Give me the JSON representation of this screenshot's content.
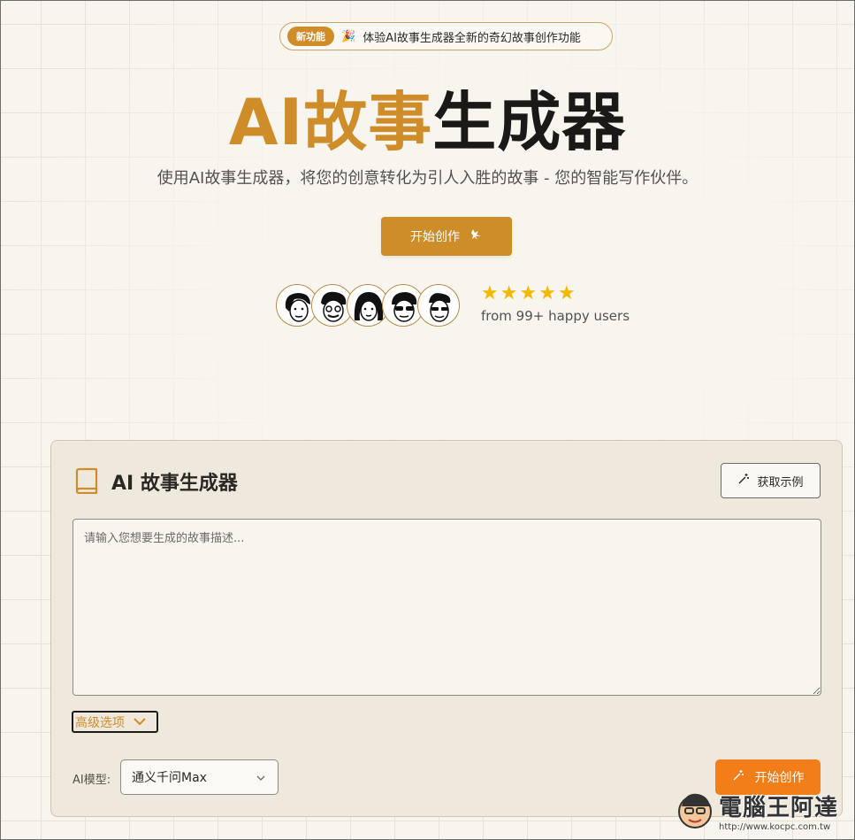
{
  "announcement": {
    "badge": "新功能",
    "text": "体验AI故事生成器全新的奇幻故事创作功能",
    "icon": "party-popper-icon"
  },
  "hero": {
    "title_accent": "AI故事",
    "title_dark": "生成器",
    "subtitle": "使用AI故事生成器，将您的创意转化为引人入胜的故事 - 您的智能写作伙伴。",
    "cta_label": "开始创作"
  },
  "social_proof": {
    "avatar_count": 5,
    "rating": 5,
    "stars": [
      "★",
      "★",
      "★",
      "★",
      "★"
    ],
    "users_text": "from 99+ happy users"
  },
  "generator": {
    "title": "AI 故事生成器",
    "example_button": "获取示例",
    "prompt_placeholder": "请输入您想要生成的故事描述...",
    "prompt_value": "",
    "advanced_label": "高级选项",
    "model_label": "AI模型:",
    "model_value": "通义千问Max",
    "submit_label": "开始创作"
  },
  "watermark": {
    "name": "電腦王阿達",
    "url": "http://www.kocpc.com.tw"
  },
  "colors": {
    "accent": "#cf8d2a",
    "submit": "#f27e1a",
    "background": "#f8f5ef",
    "card": "#efe8dd",
    "star": "#f5b800"
  }
}
